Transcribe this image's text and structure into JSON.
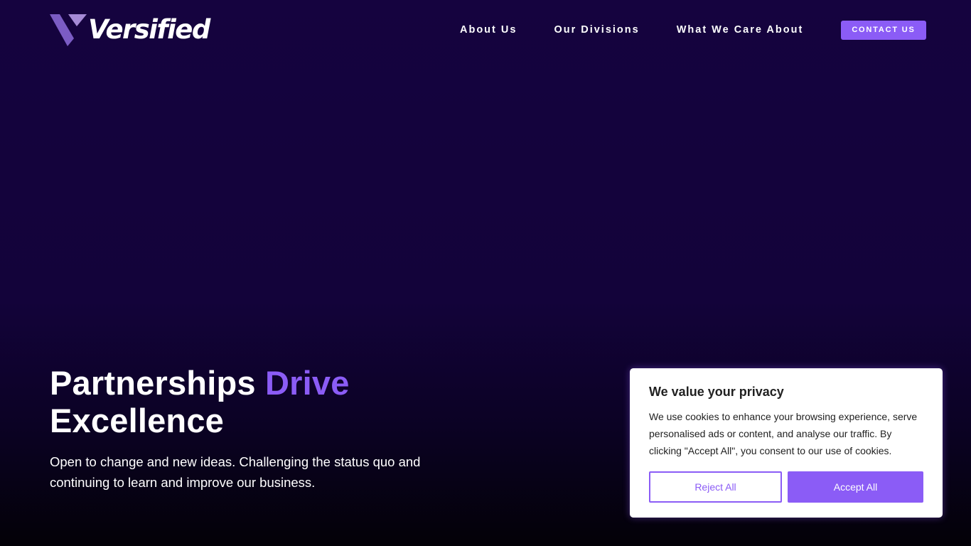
{
  "header": {
    "logo_text": "Versified",
    "nav": {
      "about": "About Us",
      "divisions": "Our Divisions",
      "care": "What We Care About"
    },
    "contact_label": "CONTACT US"
  },
  "hero": {
    "title_part1": "Partnerships",
    "title_accent": "Drive",
    "title_part2": "Excellence",
    "subtitle": "Open to change and new ideas. Challenging the status quo and continuing to learn and improve our business."
  },
  "cookie_banner": {
    "title": "We value your privacy",
    "text": "We use cookies to enhance your browsing experience, serve personalised ads or content, and analyse our traffic. By clicking \"Accept All\", you consent to our use of cookies.",
    "reject_label": "Reject All",
    "accept_label": "Accept All"
  },
  "colors": {
    "background": "#13033a",
    "accent": "#8b5cf6",
    "text_light": "#ffffff",
    "text_dark": "#212121"
  },
  "icons": {
    "logo_mark": "v-logo-mark-icon"
  }
}
